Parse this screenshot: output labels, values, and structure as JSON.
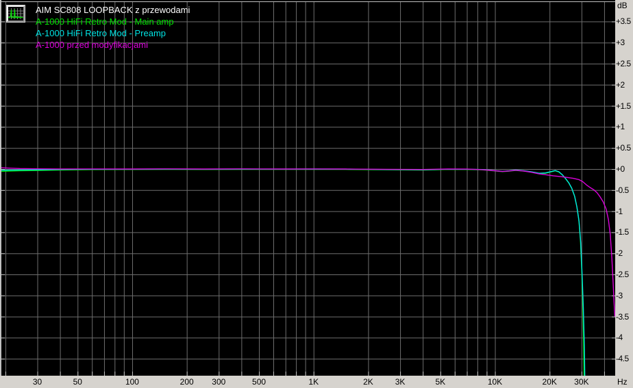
{
  "legend": {
    "icon": "spectrum-analyzer-icon"
  },
  "colors": {
    "plot_bg": "#000000",
    "grid": "#6e6e6e",
    "edge_tick": "#c2c2c2",
    "axis_strip_bg": "#d6d3ce",
    "axis_text": "#000000",
    "title_text": "#ffffff"
  },
  "chart_data": {
    "type": "line",
    "title": "AIM SC808 LOOPBACK z przewodami",
    "xlabel": "Hz",
    "ylabel": "dB",
    "xlim": [
      19,
      46000
    ],
    "ylim": [
      -4.9,
      4.0
    ],
    "grid": true,
    "legend_position": "top-left",
    "x_axis": {
      "scale": "log",
      "unit": "Hz",
      "gridlines": [
        20,
        30,
        40,
        50,
        60,
        70,
        80,
        90,
        100,
        200,
        300,
        400,
        500,
        600,
        700,
        800,
        900,
        1000,
        2000,
        3000,
        4000,
        5000,
        6000,
        7000,
        8000,
        9000,
        10000,
        20000,
        30000,
        40000
      ],
      "labels": [
        {
          "value": 30,
          "text": "30"
        },
        {
          "value": 50,
          "text": "50"
        },
        {
          "value": 100,
          "text": "100"
        },
        {
          "value": 200,
          "text": "200"
        },
        {
          "value": 300,
          "text": "300"
        },
        {
          "value": 500,
          "text": "500"
        },
        {
          "value": 1000,
          "text": "1K"
        },
        {
          "value": 2000,
          "text": "2K"
        },
        {
          "value": 3000,
          "text": "3K"
        },
        {
          "value": 5000,
          "text": "5K"
        },
        {
          "value": 10000,
          "text": "10K"
        },
        {
          "value": 20000,
          "text": "20K"
        },
        {
          "value": 30000,
          "text": "30K"
        }
      ]
    },
    "y_axis": {
      "unit": "dB",
      "gridline_step": 0.5,
      "labels": [
        {
          "value": 3.5,
          "text": "+3.5"
        },
        {
          "value": 3,
          "text": "+3"
        },
        {
          "value": 2.5,
          "text": "+2.5"
        },
        {
          "value": 2,
          "text": "+2"
        },
        {
          "value": 1.5,
          "text": "+1.5"
        },
        {
          "value": 1,
          "text": "+1"
        },
        {
          "value": 0.5,
          "text": "+0.5"
        },
        {
          "value": 0,
          "text": "+0"
        },
        {
          "value": -0.5,
          "text": "-0.5"
        },
        {
          "value": -1,
          "text": "-1"
        },
        {
          "value": -1.5,
          "text": "-1.5"
        },
        {
          "value": -2,
          "text": "-2"
        },
        {
          "value": -2.5,
          "text": "-2.5"
        },
        {
          "value": -3,
          "text": "-3"
        },
        {
          "value": -3.5,
          "text": "-3.5"
        },
        {
          "value": -4,
          "text": "-4"
        },
        {
          "value": -4.5,
          "text": "-4.5"
        }
      ]
    },
    "series": [
      {
        "name": "A-1000 HiFi Retro Mod - Main amp",
        "color": "#00e400",
        "points": [
          [
            19,
            -0.055
          ],
          [
            24,
            -0.04
          ],
          [
            30,
            -0.035
          ],
          [
            40,
            -0.022
          ],
          [
            60,
            -0.013
          ],
          [
            100,
            -0.012
          ],
          [
            150,
            -0.008
          ],
          [
            250,
            -0.012
          ],
          [
            400,
            -0.008
          ],
          [
            700,
            -0.01
          ],
          [
            1000,
            -0.008
          ],
          [
            1500,
            -0.01
          ],
          [
            2500,
            -0.018
          ],
          [
            4000,
            -0.025
          ],
          [
            5500,
            -0.01
          ],
          [
            7000,
            -0.012
          ],
          [
            8500,
            -0.02
          ],
          [
            10000,
            -0.045
          ],
          [
            11000,
            -0.062
          ],
          [
            12000,
            -0.05
          ],
          [
            13000,
            -0.032
          ],
          [
            14500,
            -0.05
          ],
          [
            16000,
            -0.075
          ],
          [
            17500,
            -0.108
          ],
          [
            19000,
            -0.1
          ],
          [
            20500,
            -0.065
          ],
          [
            21500,
            -0.042
          ],
          [
            22500,
            -0.07
          ],
          [
            23500,
            -0.14
          ],
          [
            24500,
            -0.23
          ],
          [
            25500,
            -0.33
          ],
          [
            26500,
            -0.46
          ],
          [
            27500,
            -0.65
          ],
          [
            28300,
            -0.9
          ],
          [
            29000,
            -1.2
          ],
          [
            29600,
            -1.7
          ],
          [
            30100,
            -2.4
          ],
          [
            30500,
            -3.2
          ],
          [
            30800,
            -4.1
          ],
          [
            31000,
            -4.95
          ]
        ]
      },
      {
        "name": "A-1000 HiFi Retro Mod - Preamp",
        "color": "#00e4e4",
        "points": [
          [
            19,
            -0.03
          ],
          [
            24,
            -0.022
          ],
          [
            30,
            -0.02
          ],
          [
            40,
            -0.012
          ],
          [
            60,
            -0.005
          ],
          [
            100,
            -0.004
          ],
          [
            150,
            0.0
          ],
          [
            250,
            -0.004
          ],
          [
            400,
            0.0
          ],
          [
            700,
            -0.002
          ],
          [
            1000,
            0.0
          ],
          [
            1500,
            -0.002
          ],
          [
            2500,
            -0.012
          ],
          [
            4000,
            -0.018
          ],
          [
            5500,
            -0.004
          ],
          [
            7000,
            -0.005
          ],
          [
            8500,
            -0.012
          ],
          [
            10000,
            -0.038
          ],
          [
            11000,
            -0.055
          ],
          [
            12000,
            -0.042
          ],
          [
            13000,
            -0.025
          ],
          [
            14500,
            -0.042
          ],
          [
            16000,
            -0.068
          ],
          [
            17500,
            -0.1
          ],
          [
            19000,
            -0.092
          ],
          [
            20500,
            -0.058
          ],
          [
            21500,
            -0.035
          ],
          [
            22500,
            -0.065
          ],
          [
            23500,
            -0.135
          ],
          [
            24500,
            -0.225
          ],
          [
            25500,
            -0.325
          ],
          [
            26500,
            -0.455
          ],
          [
            27500,
            -0.645
          ],
          [
            28300,
            -0.9
          ],
          [
            29100,
            -1.25
          ],
          [
            29700,
            -1.75
          ],
          [
            30200,
            -2.45
          ],
          [
            30700,
            -3.3
          ],
          [
            31100,
            -4.2
          ],
          [
            31300,
            -4.95
          ]
        ]
      },
      {
        "name": "A-1000 przed modyfikacjami",
        "color": "#dd00dd",
        "points": [
          [
            19,
            0.03
          ],
          [
            24,
            0.012
          ],
          [
            30,
            0.005
          ],
          [
            40,
            0.0
          ],
          [
            60,
            0.002
          ],
          [
            100,
            0.0
          ],
          [
            150,
            0.004
          ],
          [
            250,
            0.0
          ],
          [
            400,
            0.004
          ],
          [
            700,
            0.0
          ],
          [
            1000,
            0.002
          ],
          [
            1500,
            0.0
          ],
          [
            2500,
            -0.006
          ],
          [
            4000,
            -0.012
          ],
          [
            5500,
            0.0
          ],
          [
            7000,
            -0.002
          ],
          [
            8500,
            -0.014
          ],
          [
            10000,
            -0.04
          ],
          [
            11000,
            -0.058
          ],
          [
            12000,
            -0.045
          ],
          [
            13000,
            -0.03
          ],
          [
            14500,
            -0.048
          ],
          [
            16000,
            -0.08
          ],
          [
            17500,
            -0.115
          ],
          [
            19000,
            -0.135
          ],
          [
            21000,
            -0.16
          ],
          [
            23000,
            -0.18
          ],
          [
            25000,
            -0.2
          ],
          [
            27000,
            -0.22
          ],
          [
            29000,
            -0.25
          ],
          [
            30500,
            -0.3
          ],
          [
            32000,
            -0.38
          ],
          [
            33500,
            -0.44
          ],
          [
            35000,
            -0.49
          ],
          [
            36500,
            -0.56
          ],
          [
            38000,
            -0.66
          ],
          [
            39500,
            -0.78
          ],
          [
            41000,
            -0.95
          ],
          [
            42200,
            -1.2
          ],
          [
            43200,
            -1.55
          ],
          [
            44100,
            -2.1
          ],
          [
            44800,
            -2.7
          ],
          [
            45400,
            -3.2
          ],
          [
            45800,
            -3.5
          ]
        ]
      }
    ]
  }
}
